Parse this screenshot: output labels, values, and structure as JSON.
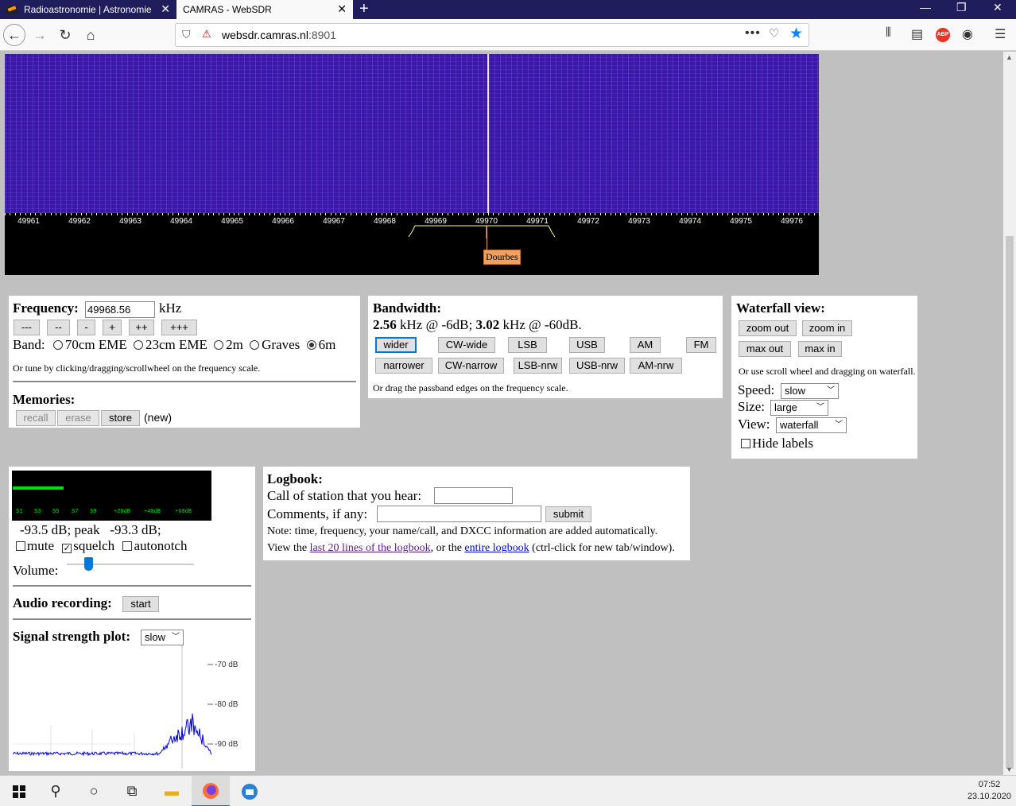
{
  "browser": {
    "tabs": [
      {
        "title": "Radioastronomie | Astronomie"
      },
      {
        "title": "CAMRAS - WebSDR"
      }
    ],
    "url_host": "websdr.camras.nl",
    "url_port": ":8901",
    "accent": "#0a84ff"
  },
  "freqscale": {
    "labels": [
      "49961",
      "49962",
      "49963",
      "49964",
      "49965",
      "49966",
      "49967",
      "49968",
      "49969",
      "49970",
      "49971",
      "49972",
      "49973",
      "49974",
      "49975",
      "49976"
    ],
    "station": "Dourbes"
  },
  "frequency": {
    "heading": "Frequency:",
    "value": "49968.56",
    "unit": "kHz",
    "step_buttons": [
      "---",
      "--",
      "-",
      "+",
      "++",
      "+++"
    ],
    "band_label": "Band:",
    "bands": [
      "70cm EME",
      "23cm EME",
      "2m",
      "Graves",
      "6m"
    ],
    "band_selected": "6m",
    "tune_hint": "Or tune by clicking/dragging/scrollwheel on the frequency scale."
  },
  "memories": {
    "heading": "Memories:",
    "recall": "recall",
    "erase": "erase",
    "store": "store",
    "new": "(new)"
  },
  "bandwidth": {
    "heading": "Bandwidth:",
    "bw6_value": "2.56",
    "bw6_text": "kHz @ -6dB;",
    "bw60_value": "3.02",
    "bw60_text": "kHz @ -60dB.",
    "row1": [
      "wider",
      "CW-wide",
      "LSB",
      "USB",
      "AM",
      "FM"
    ],
    "row2": [
      "narrower",
      "CW-narrow",
      "LSB-nrw",
      "USB-nrw",
      "AM-nrw"
    ],
    "selected": "wider",
    "hint": "Or drag the passband edges on the frequency scale."
  },
  "waterfall_view": {
    "heading": "Waterfall view:",
    "zoom_out": "zoom out",
    "zoom_in": "zoom in",
    "max_out": "max out",
    "max_in": "max in",
    "hint": "Or use scroll wheel and dragging on waterfall.",
    "speed_label": "Speed:",
    "speed_value": "slow",
    "size_label": "Size:",
    "size_value": "large",
    "view_label": "View:",
    "view_value": "waterfall",
    "hide_labels": "Hide labels"
  },
  "audio": {
    "smeter_labels": [
      "S1",
      "S3",
      "S5",
      "S7",
      "S9",
      "+20dB",
      "+40dB",
      "+60dB"
    ],
    "level_text": "-93.5 dB; peak   -93.3 dB;",
    "mute": "mute",
    "squelch": "squelch",
    "squelch_checked": true,
    "autonotch": "autonotch",
    "volume_label": "Volume:",
    "volume_level": 0.17,
    "recording_label": "Audio recording:",
    "recording_button": "start",
    "plot_label": "Signal strength plot:",
    "plot_speed": "slow",
    "plot_axis": [
      "-70 dB",
      "-80 dB",
      "-90 dB"
    ]
  },
  "logbook": {
    "heading": "Logbook:",
    "call_label": "Call of station that you hear:",
    "comments_label": "Comments, if any:",
    "submit": "submit",
    "note": "Note: time, frequency, your name/call, and DXCC information are added automatically.",
    "view_prefix": "View the",
    "link1": "last 20 lines of the logbook",
    "mid": ", or the",
    "link2": "entire logbook",
    "suffix": "(ctrl-click for new tab/window)."
  },
  "taskbar": {
    "time": "07:52",
    "date": "23.10.2020"
  }
}
